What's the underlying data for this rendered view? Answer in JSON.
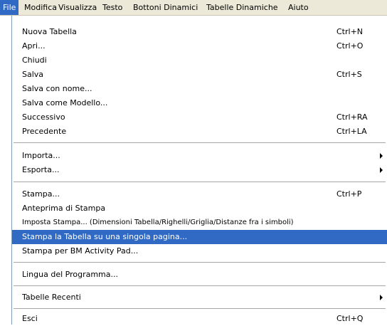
{
  "menubar": {
    "items": [
      {
        "label": "File",
        "active": true
      },
      {
        "label": "Modifica"
      },
      {
        "label": "Visualizza"
      },
      {
        "label": "Testo"
      },
      {
        "label": "Bottoni Dinamici"
      },
      {
        "label": "Tabelle Dinamiche"
      },
      {
        "label": "Aiuto"
      }
    ]
  },
  "file_menu": {
    "items": [
      {
        "label": "Nuova Tabella",
        "shortcut": "Ctrl+N"
      },
      {
        "label": "Apri...",
        "shortcut": "Ctrl+O"
      },
      {
        "label": "Chiudi",
        "shortcut": ""
      },
      {
        "label": "Salva",
        "shortcut": "Ctrl+S"
      },
      {
        "label": "Salva con nome...",
        "shortcut": ""
      },
      {
        "label": "Salva come Modello...",
        "shortcut": ""
      },
      {
        "label": "Successivo",
        "shortcut": "Ctrl+RA"
      },
      {
        "label": "Precedente",
        "shortcut": "Ctrl+LA"
      },
      {
        "label": "Importa...",
        "submenu": true
      },
      {
        "label": "Esporta...",
        "submenu": true
      },
      {
        "label": "Stampa...",
        "shortcut": "Ctrl+P"
      },
      {
        "label": "Anteprima di Stampa",
        "shortcut": ""
      },
      {
        "label": "Imposta Stampa... (Dimensioni Tabella/Righelli/Griglia/Distanze fra i simboli)",
        "shortcut": ""
      },
      {
        "label": "Stampa la Tabella su una singola pagina...",
        "shortcut": "",
        "highlighted": true
      },
      {
        "label": "Stampa per BM Activity Pad...",
        "shortcut": ""
      },
      {
        "label": "Lingua del Programma...",
        "shortcut": ""
      },
      {
        "label": "Tabelle Recenti",
        "submenu": true
      },
      {
        "label": "Esci",
        "shortcut": "Ctrl+Q"
      }
    ]
  },
  "colors": {
    "menubar_bg": "#ece9d8",
    "highlight": "#316ac5",
    "highlight_text": "#ffffff",
    "separator": "#a7a6aa"
  }
}
